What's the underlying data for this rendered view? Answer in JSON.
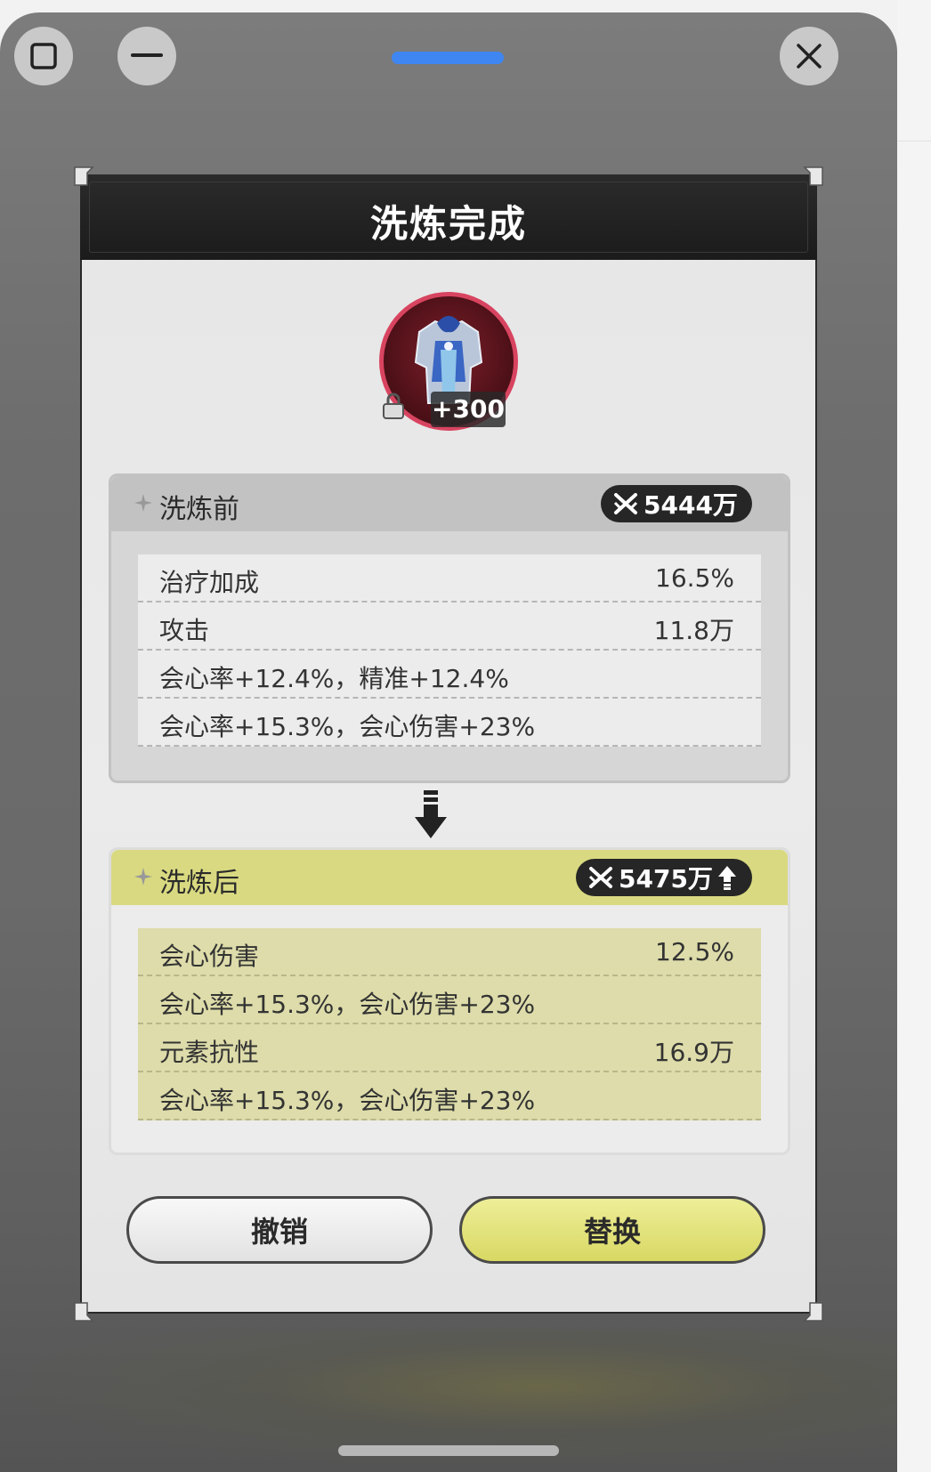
{
  "window": {
    "close_icon": "close-icon",
    "maximize_icon": "square-icon",
    "minimize_icon": "minus-icon"
  },
  "dialog": {
    "title": "洗炼完成",
    "equipment": {
      "icon": "armor-icon",
      "level": "+300",
      "locked": true
    },
    "before": {
      "label": "洗炼前",
      "score": "5444万",
      "stats": [
        {
          "name": "治疗加成",
          "value": "16.5%"
        },
        {
          "name": "攻击",
          "value": "11.8万"
        },
        {
          "name": "会心率+12.4%，精准+12.4%",
          "value": ""
        },
        {
          "name": "会心率+15.3%，会心伤害+23%",
          "value": ""
        }
      ]
    },
    "after": {
      "label": "洗炼后",
      "score": "5475万",
      "score_trend": "up",
      "stats": [
        {
          "name": "会心伤害",
          "value": "12.5%"
        },
        {
          "name": "会心率+15.3%，会心伤害+23%",
          "value": ""
        },
        {
          "name": "元素抗性",
          "value": "16.9万"
        },
        {
          "name": "会心率+15.3%，会心伤害+23%",
          "value": ""
        }
      ]
    },
    "buttons": {
      "cancel": "撤销",
      "replace": "替换"
    }
  },
  "colors": {
    "accent_yellow": "#d9d981",
    "header_dark": "#1b1b1b",
    "ring_red": "#d84460",
    "drag_handle_blue": "#3f86f2"
  }
}
